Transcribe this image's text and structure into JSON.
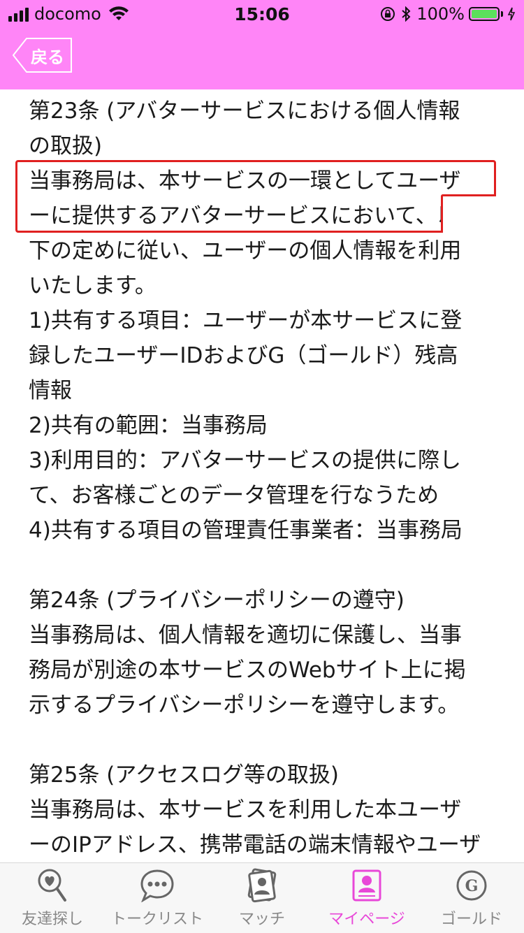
{
  "status_bar": {
    "carrier": "docomo",
    "time": "15:06",
    "battery": "100%"
  },
  "header": {
    "back_label": "戻る",
    "color": "#ff85f7"
  },
  "content": {
    "text": "第23条 (アバターサービスにおける個人情報\nの取扱)\n当事務局は、本サービスの一環としてユーザ\nーに提供するアバターサービスにおいて、以\n下の定めに従い、ユーザーの個人情報を利用\nいたします。\n1)共有する項目：ユーザーが本サービスに登\n録したユーザーIDおよびG（ゴールド）残高\n情報\n2)共有の範囲：当事務局\n3)利用目的：アバターサービスの提供に際し\nて、お客様ごとのデータ管理を行なうため\n4)共有する項目の管理責任事業者：当事務局\n\n第24条 (プライバシーポリシーの遵守)\n当事務局は、個人情報を適切に保護し、当事\n務局が別途の本サービスのWebサイト上に掲\n示するプライバシーポリシーを遵守します。\n\n第25条 (アクセスログ等の取扱)\n当事務局は、本サービスを利用した本ユーザ\nーのIPアドレス、携帯電話の端末情報やユーザ",
    "highlight_color": "#e02020"
  },
  "tabbar": {
    "active_color": "#e848d8",
    "tabs": [
      {
        "label": "友達探し",
        "icon": "heart-search-icon"
      },
      {
        "label": "トークリスト",
        "icon": "chat-bubble-icon"
      },
      {
        "label": "マッチ",
        "icon": "match-cards-icon"
      },
      {
        "label": "マイページ",
        "icon": "profile-icon"
      },
      {
        "label": "ゴールド",
        "icon": "gold-coin-icon"
      }
    ]
  }
}
